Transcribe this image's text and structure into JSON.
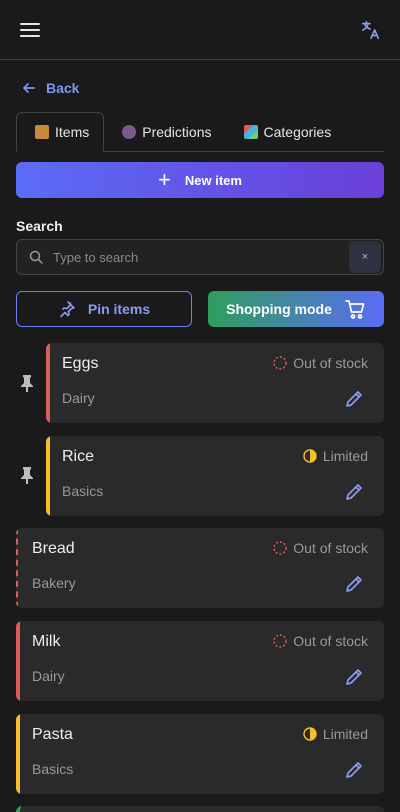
{
  "header": {
    "menu_icon": "hamburger-icon",
    "translate_icon": "translate-icon"
  },
  "nav": {
    "back_label": "Back"
  },
  "tabs": [
    {
      "label": "Items",
      "icon": "box-icon",
      "active": true
    },
    {
      "label": "Predictions",
      "icon": "crystal-ball-icon",
      "active": false
    },
    {
      "label": "Categories",
      "icon": "categories-icon",
      "active": false
    }
  ],
  "actions": {
    "new_item_label": "New item",
    "pin_items_label": "Pin items",
    "shopping_mode_label": "Shopping mode"
  },
  "search": {
    "label": "Search",
    "placeholder": "Type to search",
    "value": "",
    "clear_symbol": "×"
  },
  "items": [
    {
      "name": "Eggs",
      "category": "Dairy",
      "status": "Out of stock",
      "status_kind": "out",
      "bar_color": "#e05a5a",
      "pinned": true
    },
    {
      "name": "Rice",
      "category": "Basics",
      "status": "Limited",
      "status_kind": "limited",
      "bar_color": "#f5c02a",
      "pinned": true
    },
    {
      "name": "Bread",
      "category": "Bakery",
      "status": "Out of stock",
      "status_kind": "out",
      "bar_color": "#e05a5a",
      "pinned": false,
      "dashed": true
    },
    {
      "name": "Milk",
      "category": "Dairy",
      "status": "Out of stock",
      "status_kind": "out",
      "bar_color": "#e05a5a",
      "pinned": false
    },
    {
      "name": "Pasta",
      "category": "Basics",
      "status": "Limited",
      "status_kind": "limited",
      "bar_color": "#f5c02a",
      "pinned": false
    }
  ],
  "colors": {
    "accent": "#7f95f0",
    "out_of_stock": "#e05a5a",
    "limited": "#f5c02a",
    "in_stock": "#2f9e5c"
  }
}
